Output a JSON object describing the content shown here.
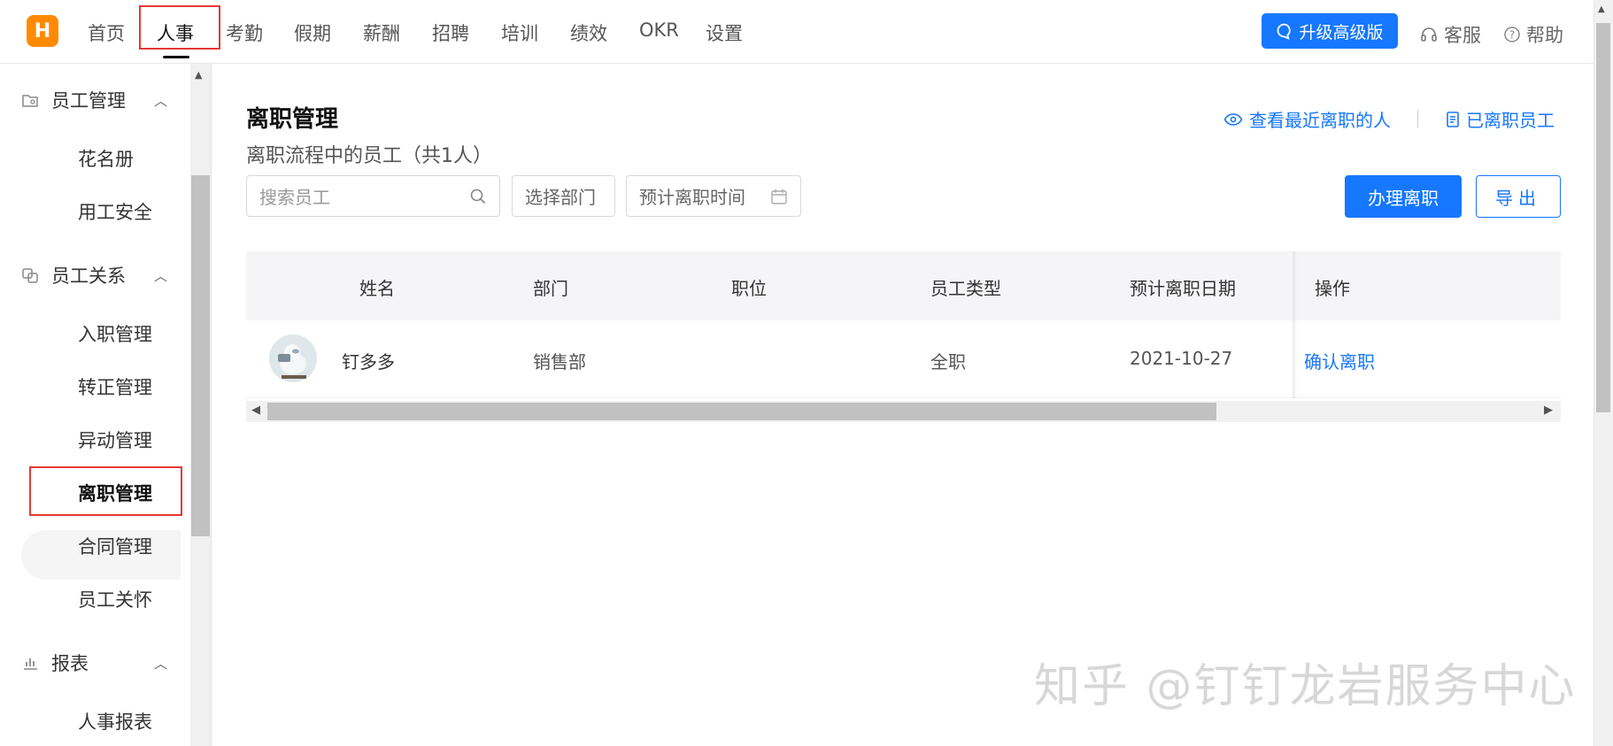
{
  "app": {
    "logo_letter": "H",
    "brand_color": "#ff8a00",
    "accent": "#1677ff"
  },
  "nav": {
    "items": [
      {
        "label": "首页"
      },
      {
        "label": "人事"
      },
      {
        "label": "考勤"
      },
      {
        "label": "假期"
      },
      {
        "label": "薪酬"
      },
      {
        "label": "招聘"
      },
      {
        "label": "培训"
      },
      {
        "label": "绩效"
      },
      {
        "label": "OKR"
      },
      {
        "label": "设置"
      }
    ],
    "active": "人事",
    "upgrade_label": "升级高级版",
    "service_label": "客服",
    "help_label": "帮助"
  },
  "sidebar": {
    "groups": [
      {
        "label": "员工管理",
        "icon": "folder-user-icon",
        "items": [
          "花名册",
          "用工安全"
        ]
      },
      {
        "label": "员工关系",
        "icon": "relation-icon",
        "items": [
          "入职管理",
          "转正管理",
          "异动管理",
          "离职管理",
          "合同管理",
          "员工关怀"
        ]
      },
      {
        "label": "报表",
        "icon": "bar-chart-icon",
        "items": [
          "人事报表"
        ]
      }
    ],
    "active_item": "离职管理"
  },
  "page": {
    "title": "离职管理",
    "subtitle": "离职流程中的员工（共1人）",
    "recent_link": "查看最近离职的人",
    "resigned_link": "已离职员工",
    "search_placeholder": "搜索员工",
    "dept_placeholder": "选择部门",
    "date_placeholder": "预计离职时间",
    "process_button": "办理离职",
    "export_button": "导出"
  },
  "table": {
    "headers": [
      "姓名",
      "部门",
      "职位",
      "员工类型",
      "预计离职日期",
      "操作"
    ],
    "rows": [
      {
        "name": "钉多多",
        "dept": "销售部",
        "position": "",
        "type": "全职",
        "date": "2021-10-27",
        "action": "确认离职"
      }
    ]
  },
  "watermark": "知乎 @钉钉龙岩服务中心"
}
